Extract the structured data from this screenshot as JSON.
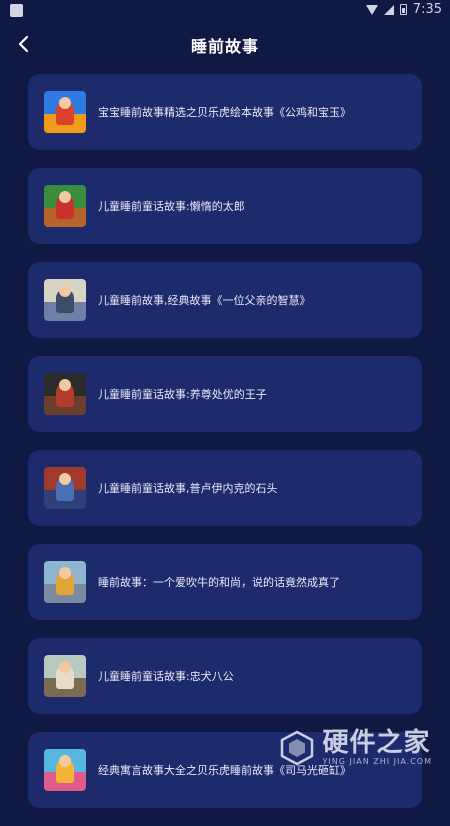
{
  "status_bar": {
    "time": "7:35"
  },
  "header": {
    "title": "睡前故事"
  },
  "stories": [
    {
      "title": "宝宝睡前故事精选之贝乐虎绘本故事《公鸡和宝玉》",
      "thumb_sky": "#2d7be0",
      "thumb_ground": "#f29a1b",
      "thumb_fig": "#d9432a"
    },
    {
      "title": "儿童睡前童话故事:懒惰的太郎",
      "thumb_sky": "#3a8d3f",
      "thumb_ground": "#b5642c",
      "thumb_fig": "#c8322d"
    },
    {
      "title": "儿童睡前故事,经典故事《一位父亲的智慧》",
      "thumb_sky": "#d7d3c5",
      "thumb_ground": "#6e7fa8",
      "thumb_fig": "#3e4a6a"
    },
    {
      "title": "儿童睡前童话故事:养尊处优的王子",
      "thumb_sky": "#2b2b2b",
      "thumb_ground": "#6b3d2a",
      "thumb_fig": "#b33b2b"
    },
    {
      "title": "儿童睡前童话故事,普卢伊内克的石头",
      "thumb_sky": "#a03a2e",
      "thumb_ground": "#2e3f7a",
      "thumb_fig": "#4a6fb5"
    },
    {
      "title": "睡前故事：一个爱吹牛的和尚，说的话竟然成真了",
      "thumb_sky": "#8fb4cf",
      "thumb_ground": "#7c8aa0",
      "thumb_fig": "#e0a63a"
    },
    {
      "title": "儿童睡前童话故事:忠犬八公",
      "thumb_sky": "#b8c9c2",
      "thumb_ground": "#7d6a55",
      "thumb_fig": "#e7dcc9"
    },
    {
      "title": "经典寓言故事大全之贝乐虎睡前故事《司马光砸缸》",
      "thumb_sky": "#57b7e0",
      "thumb_ground": "#e05a8a",
      "thumb_fig": "#f2b53a"
    }
  ],
  "watermark": {
    "name": "硬件之家",
    "sub": "YING JIAN ZHI JIA.COM"
  }
}
